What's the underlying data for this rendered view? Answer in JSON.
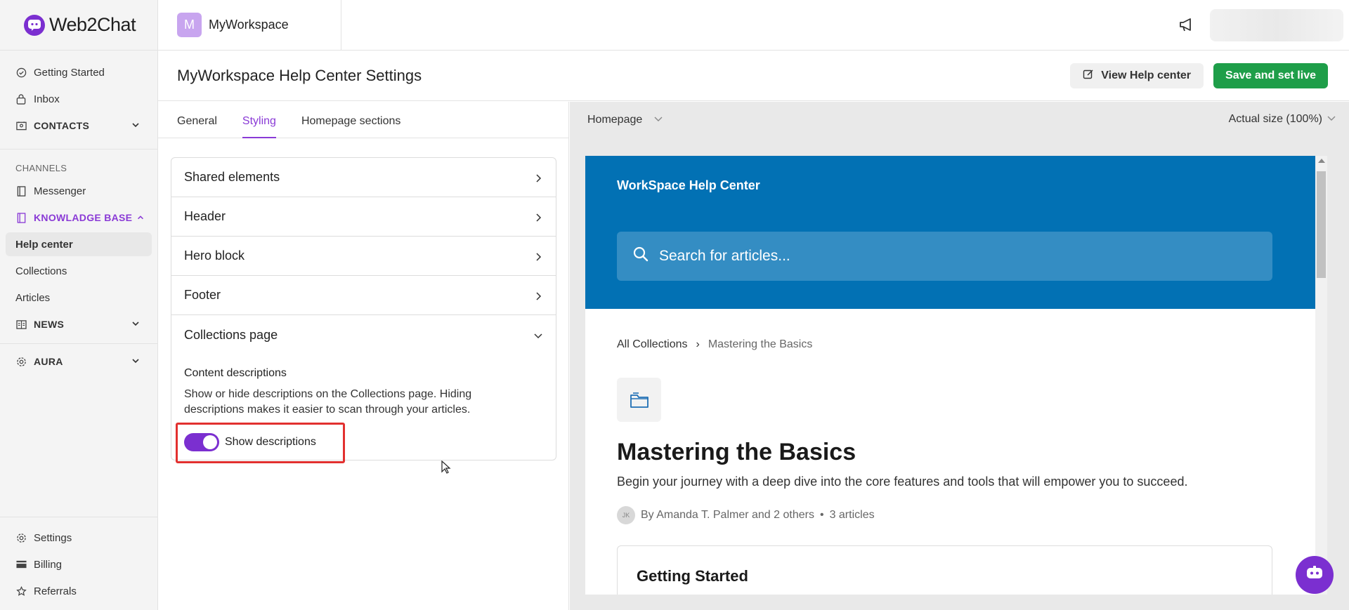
{
  "brand": {
    "name": "Web2Chat",
    "color": "#7b2fd0"
  },
  "sidebar": {
    "top_items": [
      {
        "label": "Getting Started",
        "icon": "check-circle-icon"
      },
      {
        "label": "Inbox",
        "icon": "inbox-icon"
      }
    ],
    "contacts": {
      "label": "CONTACTS",
      "icon": "contact-card-icon"
    },
    "channels_section": "CHANNELS",
    "messenger": {
      "label": "Messenger",
      "icon": "book-icon"
    },
    "knowledge_base": {
      "label": "KNOWLADGE BASE",
      "icon": "book-icon"
    },
    "kb_items": [
      "Help center",
      "Collections",
      "Articles"
    ],
    "news": {
      "label": "NEWS",
      "icon": "newspaper-icon"
    },
    "aura": {
      "label": "AURA",
      "icon": "gear-icon"
    },
    "bottom_items": [
      {
        "label": "Settings",
        "icon": "gear-icon"
      },
      {
        "label": "Billing",
        "icon": "card-icon"
      },
      {
        "label": "Referrals",
        "icon": "star-icon"
      }
    ]
  },
  "topbar": {
    "workspace_initial": "M",
    "workspace_name": "MyWorkspace"
  },
  "page": {
    "title": "MyWorkspace Help Center Settings",
    "view_button": "View Help center",
    "save_button": "Save and set live"
  },
  "settings": {
    "tabs": [
      "General",
      "Styling",
      "Homepage sections"
    ],
    "active_tab": "Styling",
    "sections": [
      "Shared elements",
      "Header",
      "Hero block",
      "Footer"
    ],
    "open_section": {
      "title": "Collections page",
      "heading": "Content descriptions",
      "description": "Show or hide descriptions on the Collections page. Hiding descriptions makes it easier to scan through your articles.",
      "toggle_label": "Show descriptions",
      "toggle_on": true
    }
  },
  "preview": {
    "page_select": "Homepage",
    "zoom": "Actual size (100%)",
    "hero_title": "WorkSpace Help Center",
    "search_placeholder": "Search for articles...",
    "breadcrumb_root": "All Collections",
    "breadcrumb_sep": "›",
    "breadcrumb_current": "Mastering the Basics",
    "collection_title": "Mastering the Basics",
    "collection_desc": "Begin your journey with a deep dive into the core features and tools that will empower you to succeed.",
    "author_initials": "JK",
    "authors": "By Amanda T. Palmer and 2 others",
    "dot": "•",
    "article_count": "3 articles",
    "card_title": "Getting Started",
    "hero_color": "#0271b4"
  }
}
